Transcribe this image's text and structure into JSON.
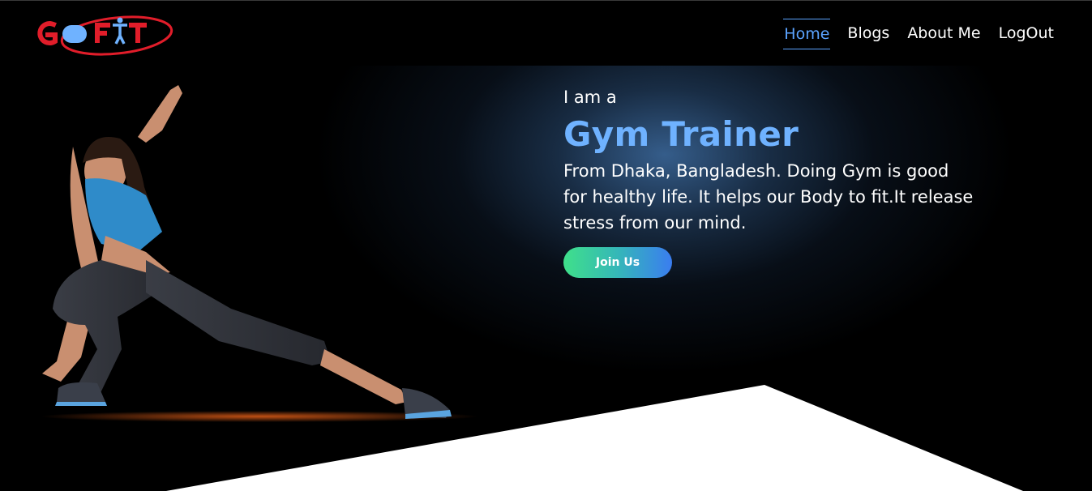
{
  "brand": {
    "logo_text": "GO FIT",
    "colors": {
      "red": "#e11d2a",
      "blue": "#6fb2ff"
    }
  },
  "nav": {
    "items": [
      {
        "label": "Home",
        "active": true
      },
      {
        "label": "Blogs",
        "active": false
      },
      {
        "label": "About Me",
        "active": false
      },
      {
        "label": "LogOut",
        "active": false
      }
    ]
  },
  "hero": {
    "intro": "I am a",
    "headline": "Gym Trainer",
    "description": "From Dhaka, Bangladesh. Doing Gym is good for healthy life. It helps our Body to fit.It release stress from our mind.",
    "cta_label": "Join Us",
    "image_subject": "woman-stretching-lunge-photo"
  },
  "theme": {
    "accent": "#5ba3ff",
    "button_gradient": [
      "#3fe08a",
      "#3a7df0"
    ],
    "background": "#000000"
  }
}
